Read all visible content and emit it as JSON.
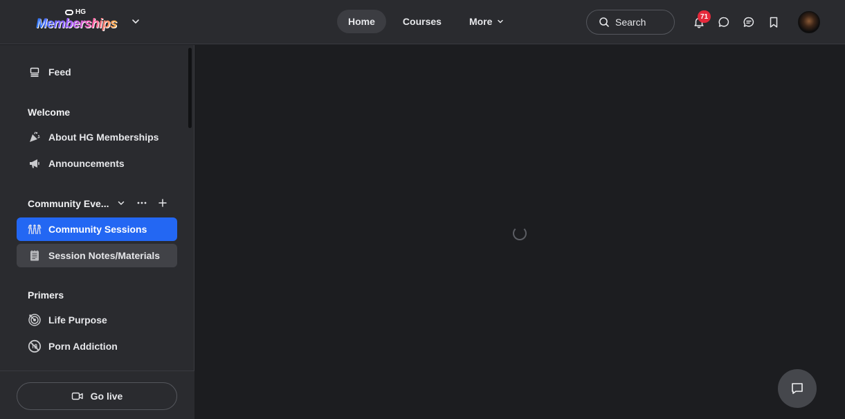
{
  "brand": {
    "top_text": "HG",
    "wordmark": "Memberships"
  },
  "nav": {
    "items": [
      {
        "label": "Home",
        "active": true
      },
      {
        "label": "Courses"
      },
      {
        "label": "More"
      }
    ]
  },
  "search": {
    "label": "Search"
  },
  "notifications": {
    "count": "71"
  },
  "sidebar": {
    "feed": "Feed",
    "sections": [
      {
        "title": "Welcome",
        "items": [
          {
            "label": "About HG Memberships",
            "icon": "confetti-icon"
          },
          {
            "label": "Announcements",
            "icon": "megaphone-icon"
          }
        ]
      },
      {
        "title": "Community Eve...",
        "items": [
          {
            "label": "Community Sessions",
            "icon": "people-icon",
            "active": true
          },
          {
            "label": "Session Notes/Materials",
            "icon": "notes-icon"
          }
        ]
      },
      {
        "title": "Primers",
        "items": [
          {
            "label": "Life Purpose",
            "icon": "target-icon"
          },
          {
            "label": "Porn Addiction",
            "icon": "no-18-icon"
          }
        ]
      }
    ],
    "go_live": "Go live"
  },
  "colors": {
    "accent": "#2367f3",
    "badge": "#e5293b",
    "header_bg": "#2a2b2f",
    "main_bg": "#1c1d20"
  }
}
